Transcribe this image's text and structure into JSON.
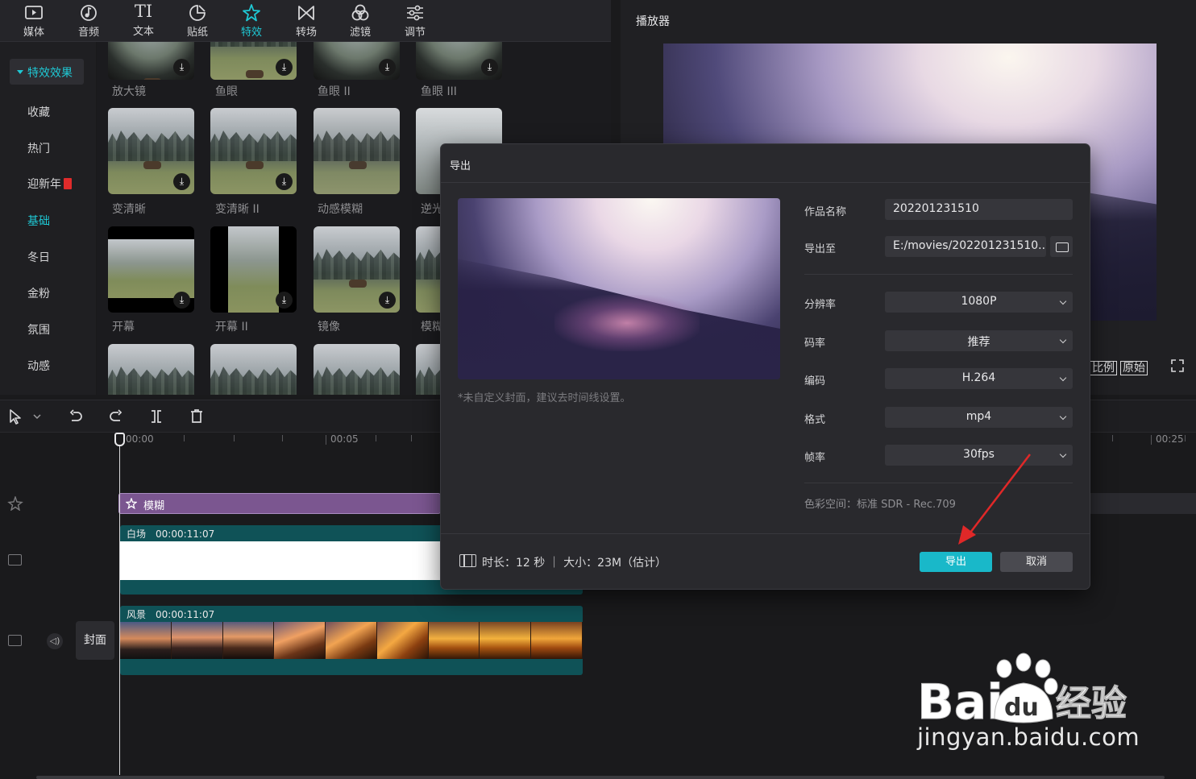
{
  "toolbar": {
    "items": [
      {
        "label": "媒体",
        "icon": "media-icon"
      },
      {
        "label": "音频",
        "icon": "audio-icon"
      },
      {
        "label": "文本",
        "icon": "text-icon",
        "glyph": "TI"
      },
      {
        "label": "贴纸",
        "icon": "sticker-icon"
      },
      {
        "label": "特效",
        "icon": "effects-icon",
        "active": true
      },
      {
        "label": "转场",
        "icon": "transition-icon"
      },
      {
        "label": "滤镜",
        "icon": "filter-icon"
      },
      {
        "label": "调节",
        "icon": "adjust-icon"
      }
    ]
  },
  "sidebar": {
    "header": "特效效果",
    "items": [
      "收藏",
      "热门",
      "迎新年",
      "基础",
      "冬日",
      "金粉",
      "氛围",
      "动感"
    ],
    "selected": "基础"
  },
  "effects": {
    "row1": [
      "放大镜",
      "鱼眼",
      "鱼眼 II",
      "鱼眼 III"
    ],
    "row2": [
      "变清晰",
      "变清晰 II",
      "动感模糊",
      "逆光"
    ],
    "row3": [
      "开幕",
      "开幕 II",
      "镜像",
      "模糊"
    ]
  },
  "player": {
    "title": "播放器",
    "btn_ratio": "比例",
    "btn_original": "原始"
  },
  "timeline": {
    "ruler": [
      "00:00",
      "00:05",
      "00:25"
    ],
    "fx_clip": "模糊",
    "clip1": {
      "name": "白场",
      "duration": "00:00:11:07"
    },
    "clip2": {
      "name": "风景",
      "duration": "00:00:11:07"
    },
    "cover_label": "封面"
  },
  "export_dialog": {
    "title": "导出",
    "cover_hint": "*未自定义封面，建议去时间线设置。",
    "name_label": "作品名称",
    "name_value": "202201231510",
    "path_label": "导出至",
    "path_value": "E:/movies/202201231510...",
    "resolution_label": "分辨率",
    "resolution_value": "1080P",
    "bitrate_label": "码率",
    "bitrate_value": "推荐",
    "codec_label": "编码",
    "codec_value": "H.264",
    "format_label": "格式",
    "format_value": "mp4",
    "framerate_label": "帧率",
    "framerate_value": "30fps",
    "colorspace": "色彩空间：标准 SDR - Rec.709",
    "duration_info": "时长：12 秒 ｜ 大小：23M（估计）",
    "export_button": "导出",
    "cancel_button": "取消"
  },
  "colors": {
    "accent": "#1fc8d4",
    "export_button": "#19b8c9",
    "fx_track": "#7b5690",
    "video_track": "#0f5257",
    "annotation_arrow": "#e02828"
  },
  "watermark": {
    "brand": "Baidu经验",
    "url": "jingyan.baidu.com"
  }
}
